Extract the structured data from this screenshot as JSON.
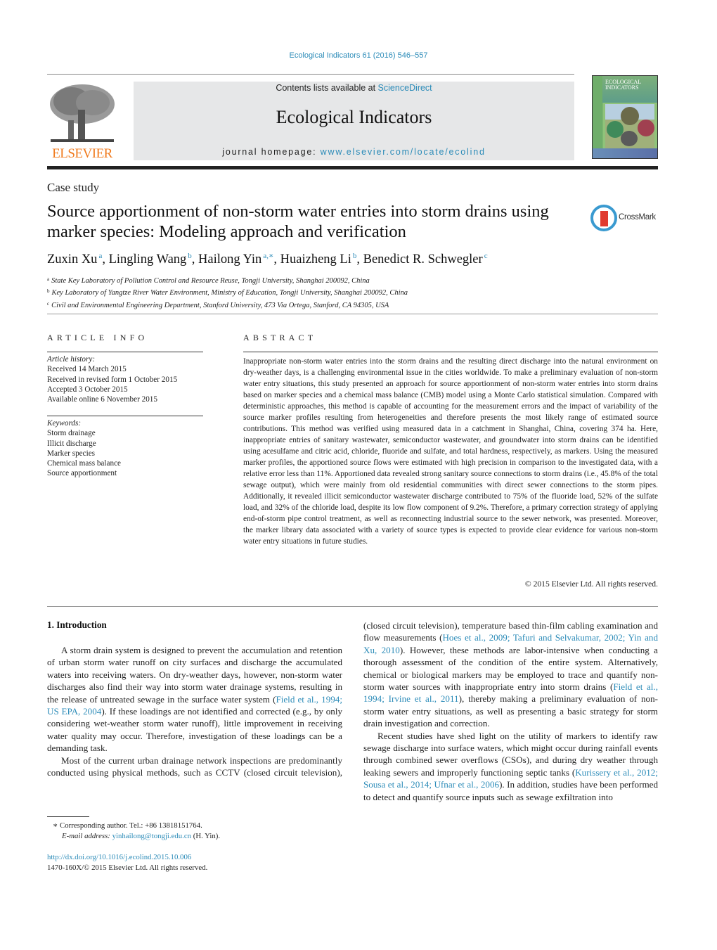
{
  "header": {
    "citation": "Ecological Indicators 61 (2016) 546–557",
    "contents_prefix": "Contents lists available at ",
    "contents_link": "ScienceDirect",
    "journal_title": "Ecological Indicators",
    "homepage_prefix": "journal homepage: ",
    "homepage_link": "www.elsevier.com/locate/ecolind",
    "publisher_logo": "ELSEVIER",
    "cover_title_1": "ECOLOGICAL",
    "cover_title_2": "INDICATORS",
    "crossmark_label": "CrossMark"
  },
  "article": {
    "type": "Case study",
    "title": "Source apportionment of non-storm water entries into storm drains using marker species: Modeling approach and verification",
    "authors": [
      {
        "name": "Zuxin Xu",
        "aff": "a"
      },
      {
        "name": "Lingling Wang",
        "aff": "b"
      },
      {
        "name": "Hailong Yin",
        "aff": "a,∗"
      },
      {
        "name": "Huaizheng Li",
        "aff": "b"
      },
      {
        "name": "Benedict R. Schwegler",
        "aff": "c"
      }
    ],
    "affiliations": [
      {
        "mark": "a",
        "text": "State Key Laboratory of Pollution Control and Resource Reuse, Tongji University, Shanghai 200092, China"
      },
      {
        "mark": "b",
        "text": "Key Laboratory of Yangtze River Water Environment, Ministry of Education, Tongji University, Shanghai 200092, China"
      },
      {
        "mark": "c",
        "text": "Civil and Environmental Engineering Department, Stanford University, 473 Via Ortega, Stanford, CA 94305, USA"
      }
    ]
  },
  "article_info": {
    "heading": "ARTICLE INFO",
    "history_label": "Article history:",
    "history": [
      "Received 14 March 2015",
      "Received in revised form 1 October 2015",
      "Accepted 3 October 2015",
      "Available online 6 November 2015"
    ],
    "keywords_label": "Keywords:",
    "keywords": [
      "Storm drainage",
      "Illicit discharge",
      "Marker species",
      "Chemical mass balance",
      "Source apportionment"
    ]
  },
  "abstract": {
    "heading": "ABSTRACT",
    "text": "Inappropriate non-storm water entries into the storm drains and the resulting direct discharge into the natural environment on dry-weather days, is a challenging environmental issue in the cities worldwide. To make a preliminary evaluation of non-storm water entry situations, this study presented an approach for source apportionment of non-storm water entries into storm drains based on marker species and a chemical mass balance (CMB) model using a Monte Carlo statistical simulation. Compared with deterministic approaches, this method is capable of accounting for the measurement errors and the impact of variability of the source marker profiles resulting from heterogeneities and therefore presents the most likely range of estimated source contributions. This method was verified using measured data in a catchment in Shanghai, China, covering 374 ha. Here, inappropriate entries of sanitary wastewater, semiconductor wastewater, and groundwater into storm drains can be identified using acesulfame and citric acid, chloride, fluoride and sulfate, and total hardness, respectively, as markers. Using the measured marker profiles, the apportioned source flows were estimated with high precision in comparison to the investigated data, with a relative error less than 11%. Apportioned data revealed strong sanitary source connections to storm drains (i.e., 45.8% of the total sewage output), which were mainly from old residential communities with direct sewer connections to the storm pipes. Additionally, it revealed illicit semiconductor wastewater discharge contributed to 75% of the fluoride load, 52% of the sulfate load, and 32% of the chloride load, despite its low flow component of 9.2%. Therefore, a primary correction strategy of applying end-of-storm pipe control treatment, as well as reconnecting industrial source to the sewer network, was presented. Moreover, the marker library data associated with a variety of source types is expected to provide clear evidence for various non-storm water entry situations in future studies.",
    "copyright": "© 2015 Elsevier Ltd. All rights reserved."
  },
  "introduction": {
    "heading": "1.  Introduction",
    "p1_a": "A storm drain system is designed to prevent the accumulation and retention of urban storm water runoff on city surfaces and discharge the accumulated waters into receiving waters. On dry-weather days, however, non-storm water discharges also find their way into storm water drainage systems, resulting in the release of untreated sewage in the surface water system (",
    "p1_ref": "Field et al., 1994; US EPA, 2004",
    "p1_b": "). If these loadings are not identified and corrected (e.g., by only considering wet-weather storm water runoff), little improvement in receiving water quality may occur. Therefore, investigation of these loadings can be a demanding task.",
    "p2_a": "Most of the current urban drainage network inspections are predominantly conducted using physical methods, such as CCTV (closed circuit television), temperature based thin-film cabling examination and flow measurements (",
    "p2_ref1": "Hoes et al., 2009; Tafuri and Selvakumar, 2002; Yin and Xu, 2010",
    "p2_b": "). However, these methods are labor-intensive when conducting a thorough assessment of the condition of the entire system. Alternatively, chemical or biological markers may be employed to trace and quantify non-storm water sources with inappropriate entry into storm drains (",
    "p2_ref2": "Field et al., 1994; Irvine et al., 2011",
    "p2_c": "), thereby making a preliminary evaluation of non-storm water entry situations, as well as presenting a basic strategy for storm drain investigation and correction.",
    "p3_a": "Recent studies have shed light on the utility of markers to identify raw sewage discharge into surface waters, which might occur during rainfall events through combined sewer overflows (CSOs), and during dry weather through leaking sewers and improperly functioning septic tanks (",
    "p3_ref": "Kurissery et al., 2012; Sousa et al., 2014; Ufnar et al., 2006",
    "p3_b": "). In addition, studies have been performed to detect and quantify source inputs such as sewage exfiltration into"
  },
  "footnotes": {
    "corresponding": "∗  Corresponding author. Tel.: +86 13818151764.",
    "email_label": "E-mail address: ",
    "email": "yinhailong@tongji.edu.cn",
    "email_suffix": " (H. Yin).",
    "doi": "http://dx.doi.org/10.1016/j.ecolind.2015.10.006",
    "issn": "1470-160X/© 2015 Elsevier Ltd. All rights reserved."
  }
}
